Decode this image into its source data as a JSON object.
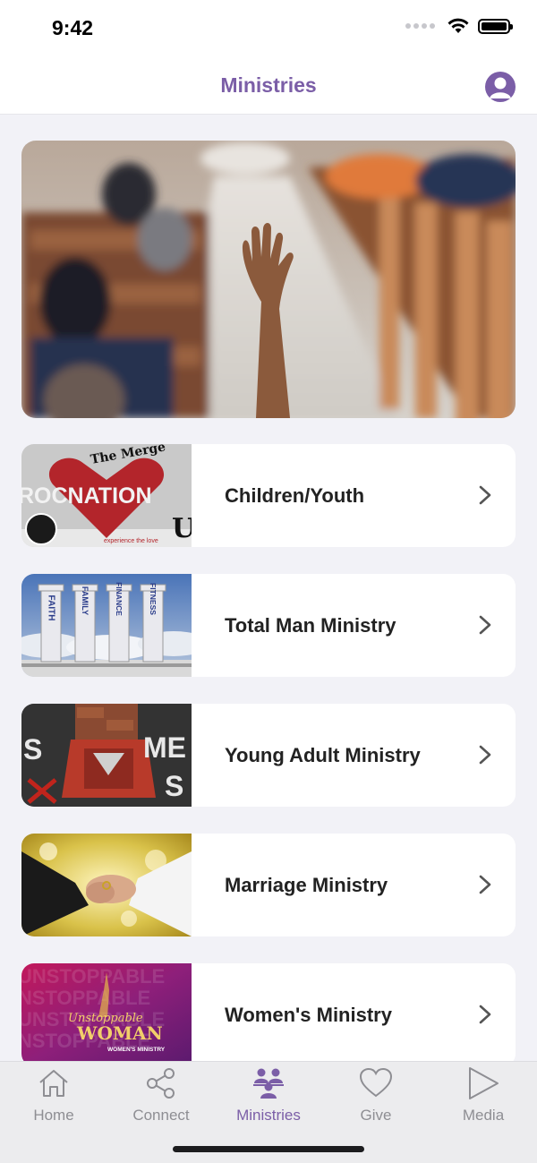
{
  "status_bar": {
    "time": "9:42"
  },
  "header": {
    "title": "Ministries"
  },
  "hero": {
    "icon": "church-worship-photo"
  },
  "ministries": [
    {
      "label": "Children/Youth",
      "thumb_text_1": "The Merge",
      "thumb_text_2": "ROCNATION",
      "thumb_text_3": "experience the love"
    },
    {
      "label": "Total Man Ministry",
      "thumb_words": [
        "FAITH",
        "FAMILY",
        "FINANCE",
        "FITNESS"
      ]
    },
    {
      "label": "Young Adult Ministry",
      "thumb_text_1": "ME",
      "thumb_text_2": "S",
      "thumb_text_3": "S"
    },
    {
      "label": "Marriage Ministry"
    },
    {
      "label": "Women's Ministry",
      "thumb_text_1": "Unstoppable",
      "thumb_text_2": "WOMAN",
      "thumb_text_3": "WOMEN'S MINISTRY"
    }
  ],
  "tabs": [
    {
      "label": "Home",
      "icon": "home-icon"
    },
    {
      "label": "Connect",
      "icon": "share-icon"
    },
    {
      "label": "Ministries",
      "icon": "people-icon",
      "active": true
    },
    {
      "label": "Give",
      "icon": "heart-icon"
    },
    {
      "label": "Media",
      "icon": "play-icon"
    }
  ],
  "colors": {
    "accent": "#7b5ea7",
    "tab_inactive": "#8e8e93"
  }
}
